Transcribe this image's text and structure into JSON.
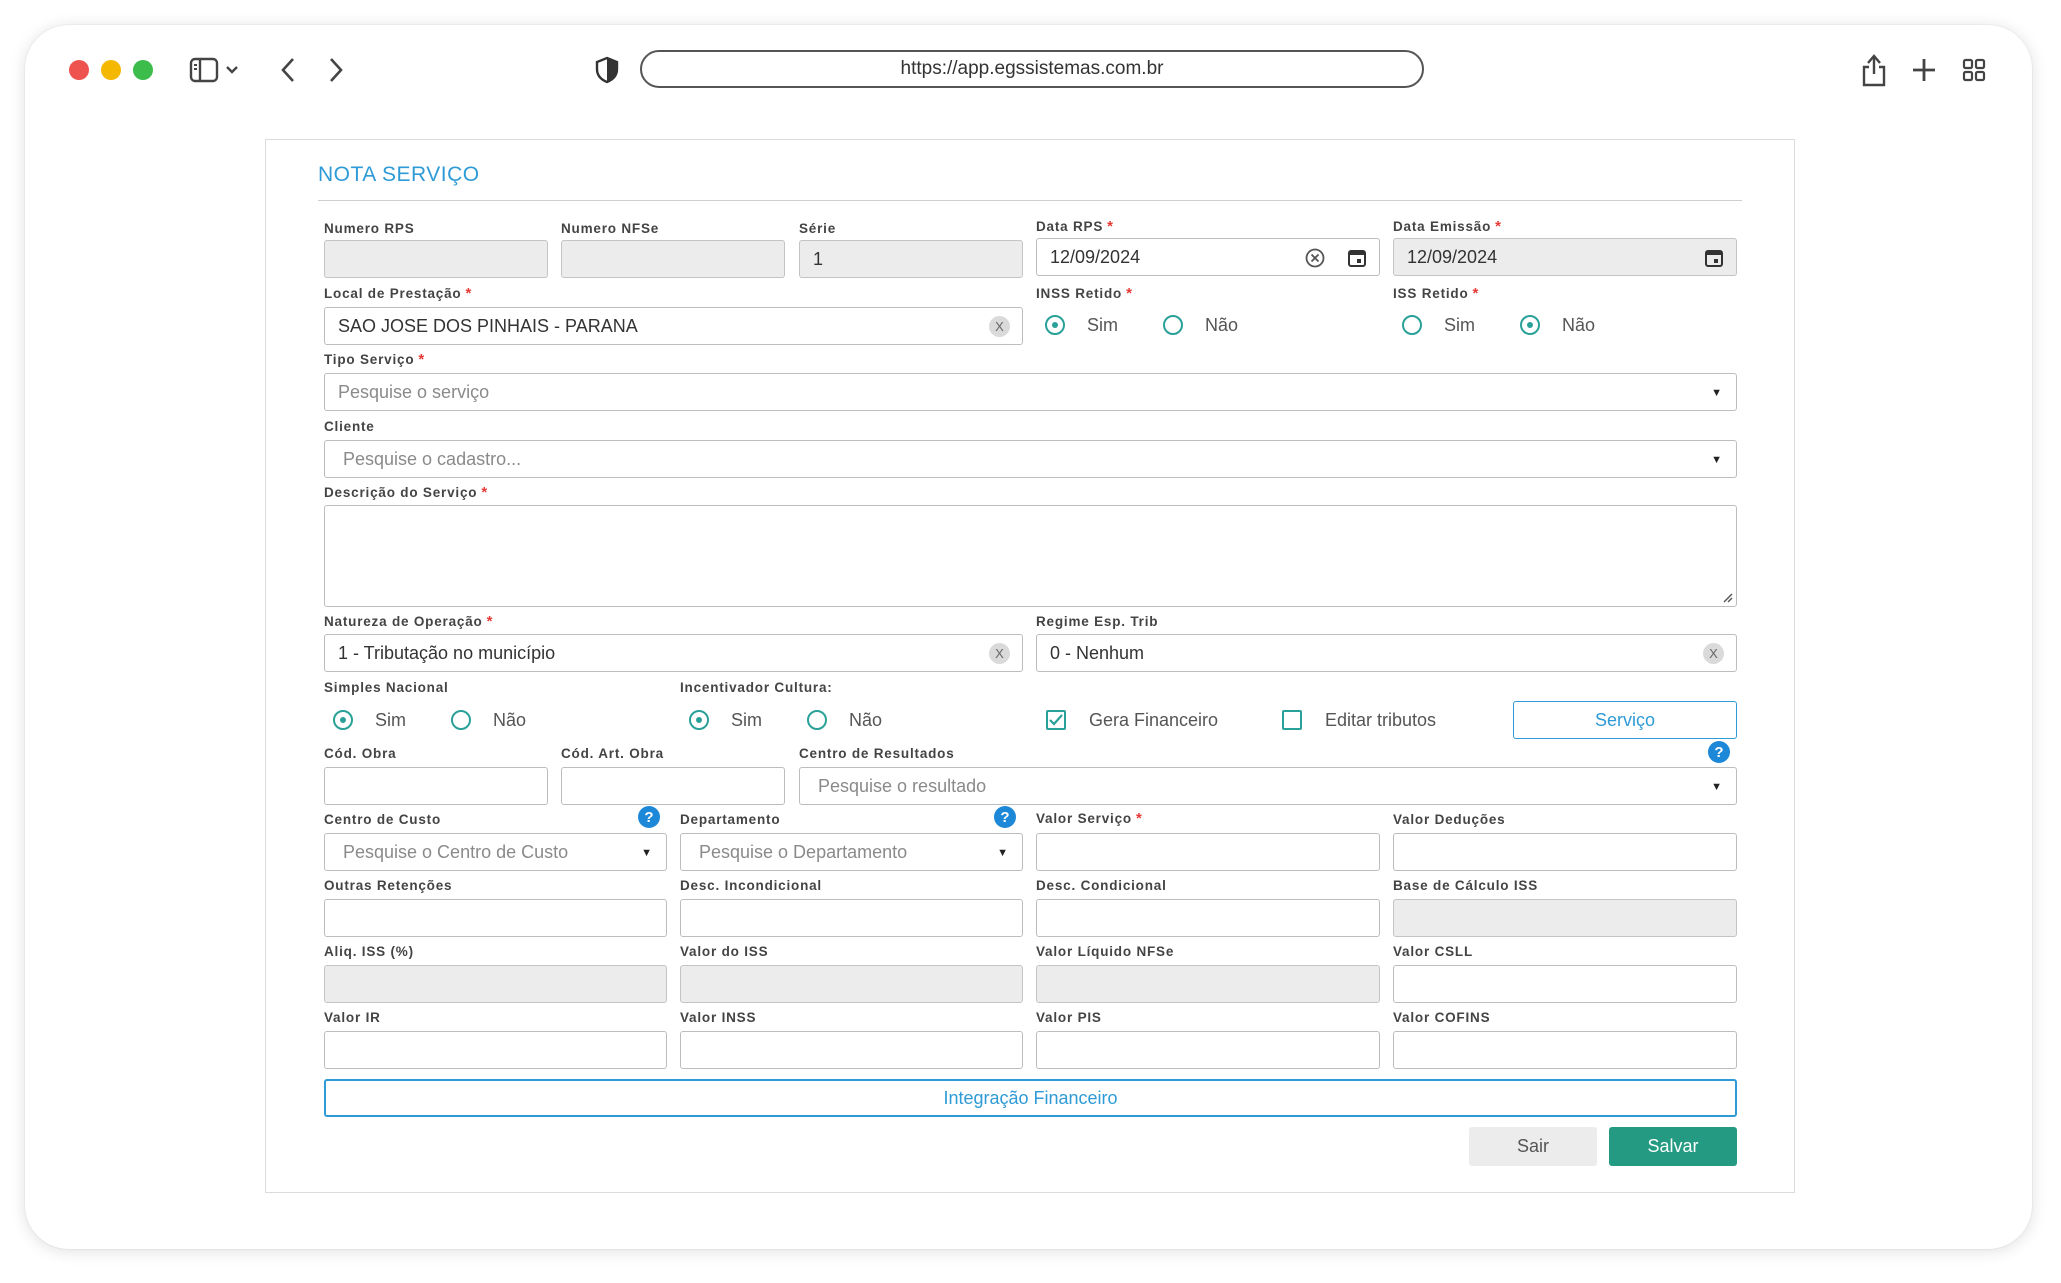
{
  "browser": {
    "url": "https://app.egssistemas.com.br"
  },
  "form": {
    "title": "NOTA SERVIÇO",
    "numero_rps": {
      "label": "Numero RPS",
      "value": ""
    },
    "numero_nfse": {
      "label": "Numero NFSe",
      "value": ""
    },
    "serie": {
      "label": "Série",
      "value": "1"
    },
    "data_rps": {
      "label": "Data RPS",
      "value": "12/09/2024"
    },
    "data_emissao": {
      "label": "Data Emissão",
      "value": "12/09/2024"
    },
    "local_prestacao": {
      "label": "Local de Prestação",
      "value": "SAO JOSE DOS PINHAIS - PARANA",
      "clear": "X"
    },
    "inss_retido": {
      "label": "INSS Retido",
      "sim": "Sim",
      "nao": "Não",
      "selected": "Sim"
    },
    "iss_retido": {
      "label": "ISS Retido",
      "sim": "Sim",
      "nao": "Não",
      "selected": "Não"
    },
    "tipo_servico": {
      "label": "Tipo Serviço",
      "placeholder": "Pesquise o serviço"
    },
    "cliente": {
      "label": "Cliente",
      "placeholder": "Pesquise o cadastro..."
    },
    "descricao": {
      "label": "Descrição do Serviço",
      "value": ""
    },
    "natureza_operacao": {
      "label": "Natureza de Operação",
      "value": "1 - Tributação no município",
      "clear": "X"
    },
    "regime_esp_trib": {
      "label": "Regime Esp. Trib",
      "value": "0 - Nenhum",
      "clear": "X"
    },
    "simples_nacional": {
      "label": "Simples Nacional",
      "sim": "Sim",
      "nao": "Não",
      "selected": "Sim"
    },
    "incentivador_cultura": {
      "label": "Incentivador Cultura:",
      "sim": "Sim",
      "nao": "Não",
      "selected": "Sim"
    },
    "gera_financeiro": {
      "label": "Gera Financeiro",
      "checked": true
    },
    "editar_tributos": {
      "label": "Editar tributos",
      "checked": false
    },
    "servico_button": "Serviço",
    "cod_obra": {
      "label": "Cód. Obra",
      "value": ""
    },
    "cod_art_obra": {
      "label": "Cód. Art. Obra",
      "value": ""
    },
    "centro_resultados": {
      "label": "Centro de Resultados",
      "placeholder": "Pesquise o resultado"
    },
    "centro_custo": {
      "label": "Centro de Custo",
      "placeholder": "Pesquise o Centro de Custo"
    },
    "departamento": {
      "label": "Departamento",
      "placeholder": "Pesquise o Departamento"
    },
    "valor_servico": {
      "label": "Valor Serviço",
      "value": ""
    },
    "valor_deducoes": {
      "label": "Valor Deduções",
      "value": ""
    },
    "outras_retencoes": {
      "label": "Outras Retenções",
      "value": ""
    },
    "desc_incondicional": {
      "label": "Desc. Incondicional",
      "value": ""
    },
    "desc_condicional": {
      "label": "Desc. Condicional",
      "value": ""
    },
    "base_calculo_iss": {
      "label": "Base de Cálculo ISS",
      "value": ""
    },
    "aliq_iss": {
      "label": "Aliq. ISS (%)",
      "value": ""
    },
    "valor_iss": {
      "label": "Valor do ISS",
      "value": ""
    },
    "valor_liquido_nfse": {
      "label": "Valor Líquido NFSe",
      "value": ""
    },
    "valor_csll": {
      "label": "Valor CSLL",
      "value": ""
    },
    "valor_ir": {
      "label": "Valor IR",
      "value": ""
    },
    "valor_inss": {
      "label": "Valor INSS",
      "value": ""
    },
    "valor_pis": {
      "label": "Valor PIS",
      "value": ""
    },
    "valor_cofins": {
      "label": "Valor COFINS",
      "value": ""
    },
    "integracao_button": "Integração Financeiro",
    "help_glyph": "?",
    "required_mark": "*",
    "select_arrow": "▼",
    "sair_button": "Sair",
    "salvar_button": "Salvar"
  },
  "colors": {
    "accent_blue": "#2e9bd6",
    "accent_teal": "#2aa198",
    "save_green": "#239a81",
    "required_red": "#e53935"
  }
}
